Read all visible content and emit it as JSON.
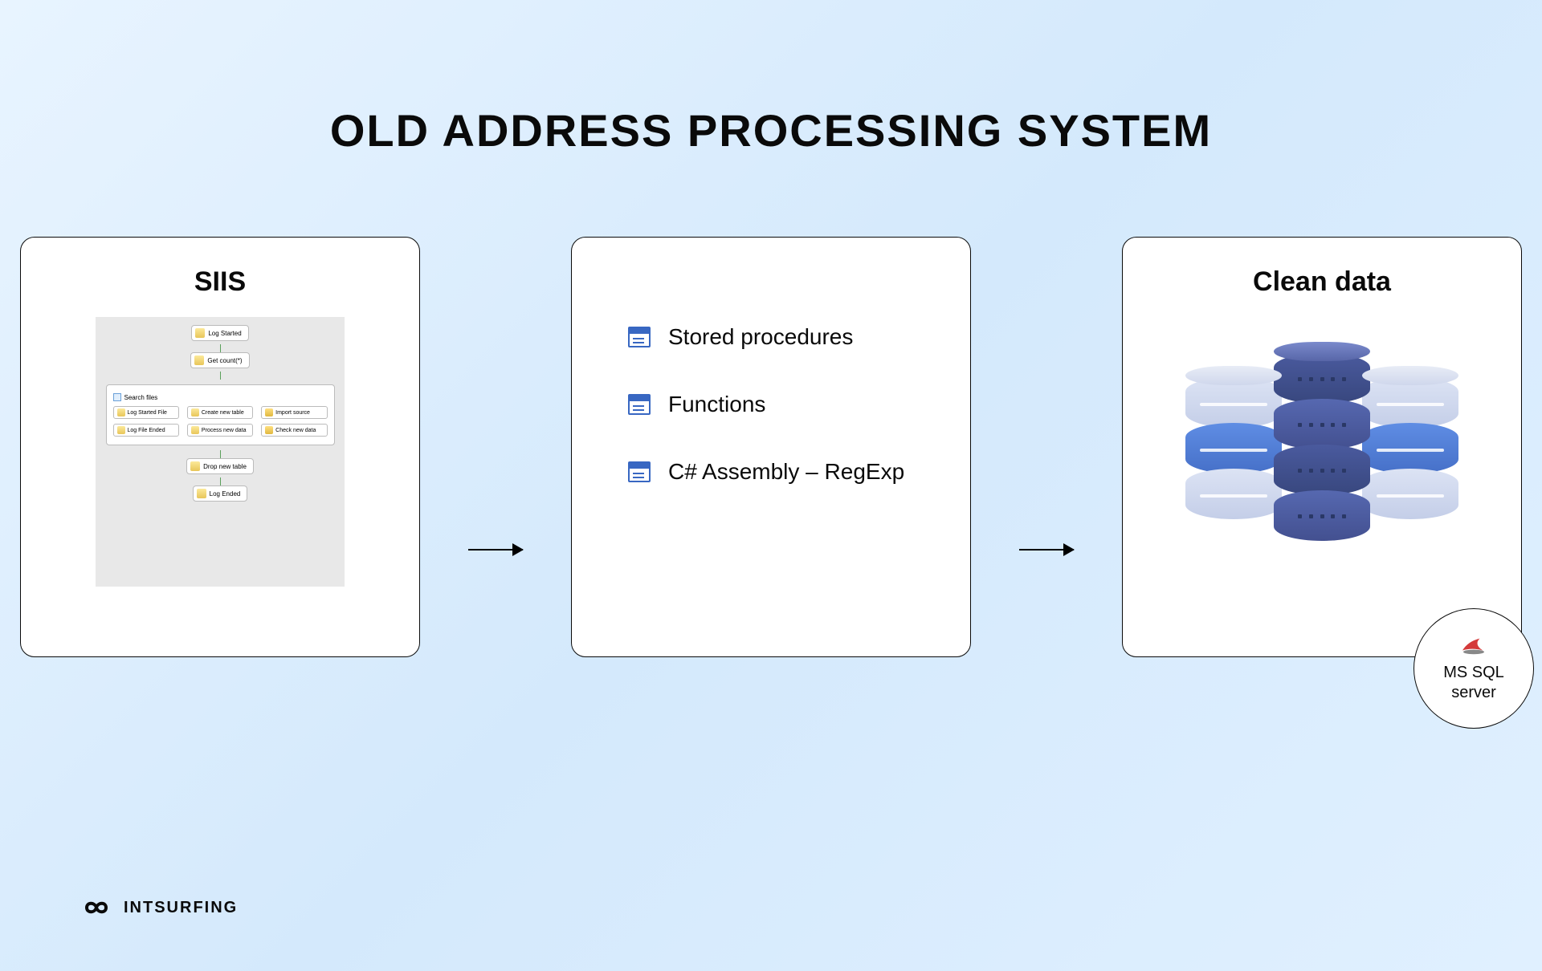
{
  "title": "OLD ADDRESS PROCESSING SYSTEM",
  "cards": {
    "siis": {
      "title": "SIIS",
      "flow": {
        "top1": "Log Started",
        "top2": "Get count(*)",
        "group_title": "Search files",
        "items": [
          "Log Started File",
          "Create new table",
          "Import source",
          "Log File Ended",
          "Process new data",
          "Check new data"
        ],
        "bottom1": "Drop new table",
        "bottom2": "Log Ended"
      }
    },
    "middle": {
      "items": [
        "Stored procedures",
        "Functions",
        "C# Assembly – RegExp"
      ]
    },
    "clean": {
      "title": "Clean data",
      "badge": "MS SQL\nserver"
    }
  },
  "brand": "INTSURFING"
}
